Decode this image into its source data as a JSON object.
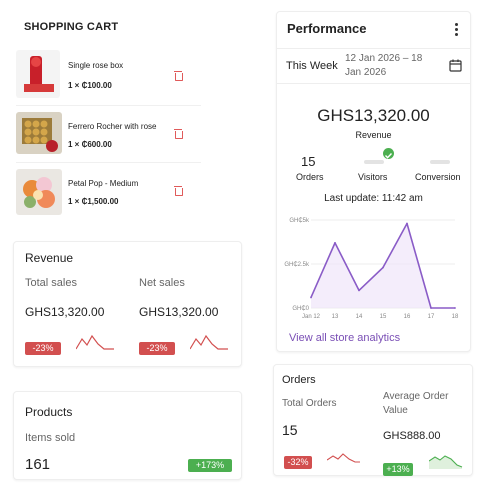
{
  "cart": {
    "title": "SHOPPING CART",
    "items": [
      {
        "name": "Single rose box",
        "qty": "1 × ₵100.00"
      },
      {
        "name": "Ferrero Rocher with rose",
        "qty": "1 × ₵600.00"
      },
      {
        "name": "Petal Pop - Medium",
        "qty": "1 × ₵1,500.00"
      }
    ]
  },
  "revenue_card": {
    "title": "Revenue",
    "total_label": "Total sales",
    "net_label": "Net sales",
    "total_value": "GHS13,320.00",
    "net_value": "GHS13,320.00",
    "total_change": "-23%",
    "net_change": "-23%"
  },
  "products_card": {
    "title": "Products",
    "items_label": "Items sold",
    "items_value": "161",
    "change": "+173%"
  },
  "performance": {
    "title": "Performance",
    "period_label": "This Week",
    "range_line1": "12 Jan 2026 – 18",
    "range_line2": "Jan 2026",
    "revenue_value": "GHS13,320.00",
    "revenue_label": "Revenue",
    "orders_value": "15",
    "orders_label": "Orders",
    "visitors_label": "Visitors",
    "conversion_label": "Conversion",
    "last_update": "Last update: 11:42 am",
    "link": "View all store analytics"
  },
  "chart_data": {
    "type": "line",
    "x": [
      "Jan 12",
      "13",
      "14",
      "15",
      "16",
      "17",
      "18"
    ],
    "y_ticks": [
      "GH₵5k",
      "GH₵2.5k",
      "GH₵0"
    ],
    "ylim": [
      0,
      5000
    ],
    "series": [
      {
        "values": [
          600,
          3700,
          1000,
          2300,
          4800,
          0,
          0
        ]
      }
    ],
    "line_color": "#8a5cc7"
  },
  "orders_card": {
    "title": "Orders",
    "total_label": "Total Orders",
    "total_value": "15",
    "avg_label_line1": "Average Order",
    "avg_label_line2": "Value",
    "avg_value": "GHS888.00",
    "total_change": "-32%",
    "avg_change": "+13%"
  }
}
